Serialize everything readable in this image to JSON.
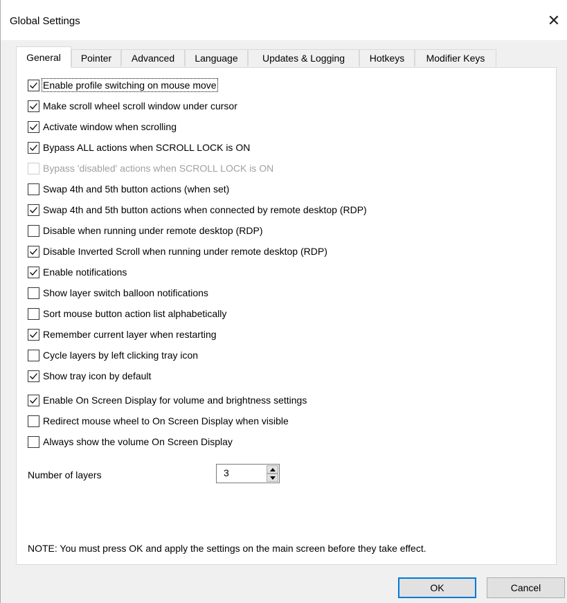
{
  "window": {
    "title": "Global Settings",
    "close_glyph": "✕"
  },
  "tabs": [
    {
      "label": "General",
      "active": true
    },
    {
      "label": "Pointer",
      "active": false
    },
    {
      "label": "Advanced",
      "active": false
    },
    {
      "label": "Language",
      "active": false
    },
    {
      "label": "Updates & Logging",
      "active": false
    },
    {
      "label": "Hotkeys",
      "active": false
    },
    {
      "label": "Modifier Keys",
      "active": false
    }
  ],
  "options": [
    {
      "label": "Enable profile switching on mouse move",
      "checked": true,
      "disabled": false,
      "focused": true
    },
    {
      "label": "Make scroll wheel scroll window under cursor",
      "checked": true,
      "disabled": false
    },
    {
      "label": "Activate window when scrolling",
      "checked": true,
      "disabled": false
    },
    {
      "label": "Bypass ALL actions when SCROLL LOCK is ON",
      "checked": true,
      "disabled": false
    },
    {
      "label": "Bypass 'disabled' actions when SCROLL LOCK is ON",
      "checked": false,
      "disabled": true
    },
    {
      "label": "Swap 4th and 5th button actions (when set)",
      "checked": false,
      "disabled": false
    },
    {
      "label": "Swap 4th and 5th button actions when connected by remote desktop (RDP)",
      "checked": true,
      "disabled": false
    },
    {
      "label": "Disable when running under remote desktop (RDP)",
      "checked": false,
      "disabled": false
    },
    {
      "label": "Disable Inverted Scroll when running under remote desktop (RDP)",
      "checked": true,
      "disabled": false
    },
    {
      "label": "Enable notifications",
      "checked": true,
      "disabled": false
    },
    {
      "label": "Show layer switch balloon notifications",
      "checked": false,
      "disabled": false
    },
    {
      "label": "Sort mouse button action list alphabetically",
      "checked": false,
      "disabled": false
    },
    {
      "label": "Remember current layer when restarting",
      "checked": true,
      "disabled": false
    },
    {
      "label": "Cycle layers by left clicking tray icon",
      "checked": false,
      "disabled": false
    },
    {
      "label": "Show tray icon by default",
      "checked": true,
      "disabled": false
    },
    {
      "label": "Enable On Screen Display for volume and brightness settings",
      "checked": true,
      "disabled": false
    },
    {
      "label": "Redirect mouse wheel to On Screen Display when visible",
      "checked": false,
      "disabled": false
    },
    {
      "label": "Always show the volume On Screen Display",
      "checked": false,
      "disabled": false
    }
  ],
  "layers": {
    "label": "Number of layers",
    "value": "3"
  },
  "note": "NOTE: You must press OK and apply the settings on the main screen before they take effect.",
  "buttons": {
    "ok": "OK",
    "cancel": "Cancel"
  },
  "colors": {
    "accent": "#0078d7",
    "dialog_bg": "#f0f0f0",
    "panel_bg": "#ffffff",
    "disabled_text": "#a0a0a0"
  }
}
